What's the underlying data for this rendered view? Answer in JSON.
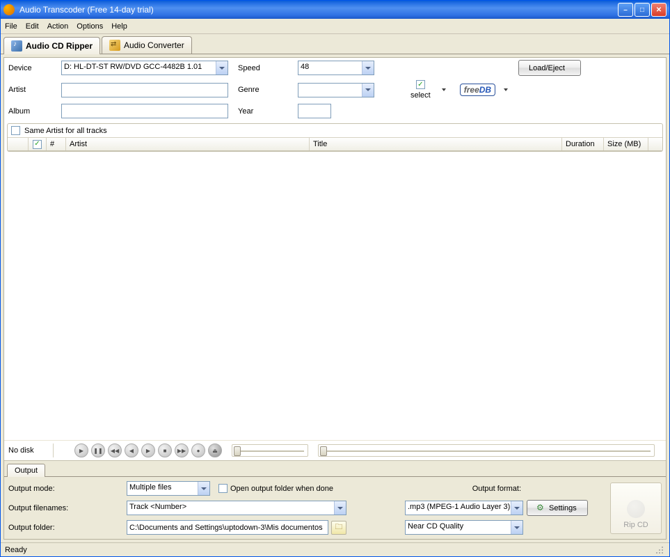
{
  "titlebar": {
    "text": "Audio Transcoder (Free 14-day trial)"
  },
  "menubar": {
    "file": "File",
    "edit": "Edit",
    "action": "Action",
    "options": "Options",
    "help": "Help"
  },
  "tabs": {
    "ripper": "Audio CD Ripper",
    "converter": "Audio Converter"
  },
  "form": {
    "device_lbl": "Device",
    "device_val": "D: HL-DT-ST RW/DVD GCC-4482B 1.01",
    "speed_lbl": "Speed",
    "speed_val": "48",
    "load_btn": "Load/Eject",
    "artist_lbl": "Artist",
    "artist_val": "",
    "album_lbl": "Album",
    "album_val": "",
    "genre_lbl": "Genre",
    "genre_val": "",
    "year_lbl": "Year",
    "year_val": "",
    "select_lbl": "select",
    "freedb_free": "free",
    "freedb_db": "DB",
    "same_artist": "Same Artist for all tracks"
  },
  "grid": {
    "num": "#",
    "artist": "Artist",
    "title": "Title",
    "duration": "Duration",
    "size": "Size (MB)"
  },
  "player": {
    "nodisk": "No disk"
  },
  "output": {
    "tab": "Output",
    "mode_lbl": "Output mode:",
    "mode_val": "Multiple files",
    "open_chk": "Open output folder when done",
    "filenames_lbl": "Output filenames:",
    "filenames_val": "Track <Number>",
    "folder_lbl": "Output folder:",
    "folder_val": "C:\\Documents and Settings\\uptodown-3\\Mis documentos",
    "format_lbl": "Output format:",
    "format_val": ".mp3 (MPEG-1 Audio Layer 3)",
    "quality_val": "Near CD Quality",
    "settings_btn": "Settings",
    "rip_btn": "Rip CD"
  },
  "status": {
    "text": "Ready"
  }
}
